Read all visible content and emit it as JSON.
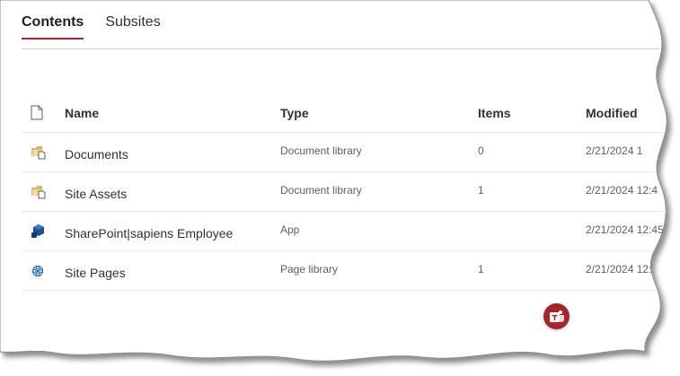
{
  "tabs": [
    {
      "label": "Contents",
      "active": true
    },
    {
      "label": "Subsites",
      "active": false
    }
  ],
  "table": {
    "headers": {
      "name": "Name",
      "type": "Type",
      "items": "Items",
      "modified": "Modified"
    },
    "rows": [
      {
        "icon": "document-library-icon",
        "name": "Documents",
        "type": "Document library",
        "items": "0",
        "modified": "2/21/2024 1"
      },
      {
        "icon": "document-library-icon",
        "name": "Site Assets",
        "type": "Document library",
        "items": "1",
        "modified": "2/21/2024 12:4"
      },
      {
        "icon": "app-icon",
        "name": "SharePoint|sapiens Employee",
        "type": "App",
        "items": "",
        "modified": "2/21/2024 12:45"
      },
      {
        "icon": "page-library-icon",
        "name": "Site Pages",
        "type": "Page library",
        "items": "1",
        "modified": "2/21/2024 12:"
      }
    ]
  },
  "colors": {
    "accent": "#a4262c",
    "app_icon": "#1e4e8c",
    "folder_icon": "#c8a567"
  }
}
